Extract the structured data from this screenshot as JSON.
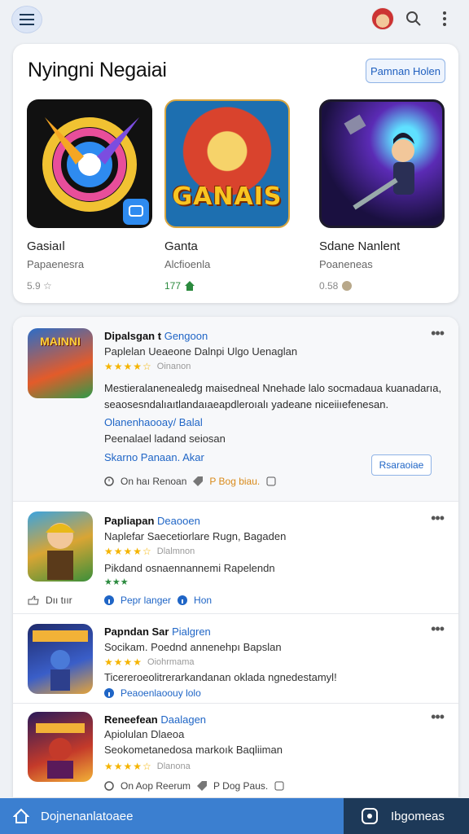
{
  "featured": {
    "title": "Nyingni Negaiai",
    "button_label": "Pamnan Holen",
    "items": [
      {
        "name": "Gasiaıl",
        "subtitle": "Papaenesra",
        "meta": "5.9 ☆"
      },
      {
        "name": "Ganta",
        "subtitle": "Alcfioenla",
        "meta": "177",
        "art_text": "GANAIS"
      },
      {
        "name": "Sdane Nanlent",
        "subtitle": "Poaneneas",
        "meta": "0.58"
      }
    ]
  },
  "list": [
    {
      "thumb_text": "MAINNI",
      "title": "Dipalsgan t",
      "title_accent": "Gengoon",
      "subtitle": "Paplelan Ueaeone Dalnpi Ulgo Uenaglan",
      "rating_text": "Oinanon",
      "description": "Mestieralanenealedg maisedneal Nnehade lalo socmadaua kuanadarıa, seaosesndalıaıtlandaıaeapdleroıalı yadeane niceiiıefenesan.",
      "tag_line": "Olanenhaooay/ Balal",
      "extra_line": "Peenalael ladand seiosan",
      "link": "Skarno Panaan. Akar",
      "footer_left": "On haı Renoan",
      "footer_accent": "P Bog biau."
    },
    {
      "title": "Papliapan",
      "title_accent": "Deaooen",
      "subtitle": "Naplefar Saecetiorlare Rugn, Bagaden",
      "rating_text": "Dlalmnon",
      "description": "Pikdand osnaennannemi Rapelendn",
      "footer_left": "Dıı  tıır",
      "footer_link": "Pepr langer",
      "footer_link_2": "Hon"
    },
    {
      "title": "Papndan Sar",
      "title_accent": "Pialgren",
      "subtitle": "Socikam. Poednd annenehpı Bapslan",
      "rating_text": "Oiohrmama",
      "description": "Ticereroeolitrerarkandanan oklada ngnedestamyl!",
      "footer_link": "Peaoenlaoouy lolo"
    },
    {
      "title": "Reneefean",
      "title_accent": "Daalagen",
      "subtitle": "Apiolulan Dlaeoa",
      "rating_text": "Dlanona",
      "description": "Seokometanedosa markoık Baqliiman",
      "footer_left": "On Aop Reerum",
      "footer_accent": "P Dog Paus.",
      "button_label": "Rsaraoiae"
    }
  ],
  "bottom": {
    "left_label": "Dojnenanlatoaee",
    "right_label": "Ibgomeas"
  },
  "colors": {
    "accent": "#1f65c6",
    "bottom_left": "#3b7fd0",
    "bottom_right": "#1d3958",
    "stars": "#f5b400"
  }
}
